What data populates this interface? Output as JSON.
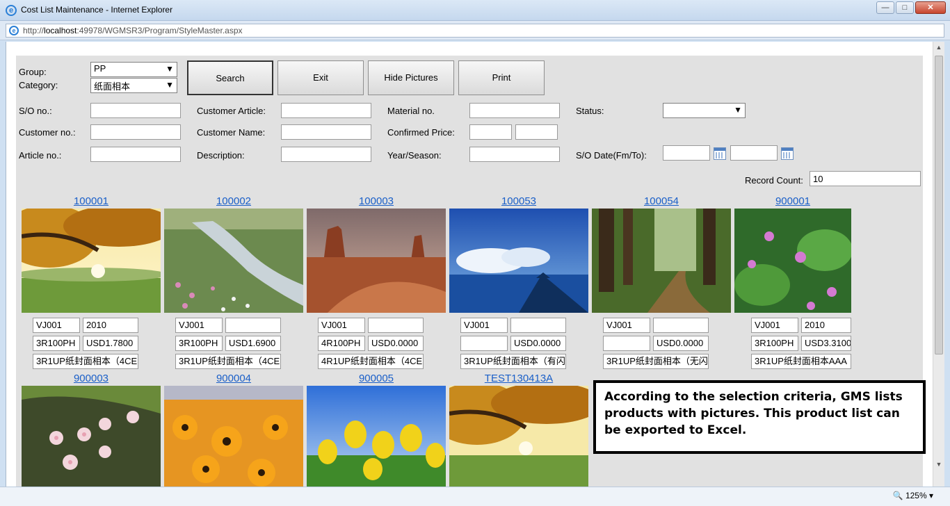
{
  "window": {
    "title": "Cost List Maintenance - Internet Explorer",
    "url_prefix": "http://",
    "url_host": "localhost",
    "url_rest": ":49978/WGMSR3/Program/StyleMaster.aspx"
  },
  "form": {
    "group_label": "Group:",
    "group_value": "PP",
    "category_label": "Category:",
    "category_value": "纸面相本",
    "buttons": {
      "search": "Search",
      "exit": "Exit",
      "hide_pictures": "Hide Pictures",
      "print": "Print"
    },
    "so_label": "S/O no.:",
    "customer_article_label": "Customer Article:",
    "material_label": "Material no.",
    "status_label": "Status:",
    "customer_no_label": "Customer no.:",
    "customer_name_label": "Customer Name:",
    "confirmed_price_label": "Confirmed Price:",
    "article_no_label": "Article no.:",
    "description_label": "Description:",
    "year_season_label": "Year/Season:",
    "so_date_label": "S/O Date(Fm/To):",
    "record_count_label": "Record Count:",
    "record_count_value": "10"
  },
  "products": [
    {
      "id": "100001",
      "a": "VJ001",
      "b": "2010",
      "c": "3R100PH",
      "d": "USD1.7800",
      "e": "3R1UP纸封面相本（4CE"
    },
    {
      "id": "100002",
      "a": "VJ001",
      "b": "",
      "c": "3R100PH",
      "d": "USD1.6900",
      "e": "3R1UP纸封面相本（4CE"
    },
    {
      "id": "100003",
      "a": "VJ001",
      "b": "",
      "c": "4R100PH",
      "d": "USD0.0000",
      "e": "4R1UP纸封面相本（4CE"
    },
    {
      "id": "100053",
      "a": "VJ001",
      "b": "",
      "c": "",
      "d": "USD0.0000",
      "e": "3R1UP纸封面相本（有闪"
    },
    {
      "id": "100054",
      "a": "VJ001",
      "b": "",
      "c": "",
      "d": "USD0.0000",
      "e": "3R1UP纸封面相本（无闪"
    },
    {
      "id": "900001",
      "a": "VJ001",
      "b": "2010",
      "c": "3R100PH",
      "d": "USD3.3100",
      "e": "3R1UP纸封面相本AAA"
    },
    {
      "id": "900003"
    },
    {
      "id": "900004"
    },
    {
      "id": "900005"
    },
    {
      "id": "TEST130413A"
    }
  ],
  "callout": "According to the selection criteria, GMS lists products with pictures.  This product list can be exported to Excel.",
  "status": {
    "zoom": "125%"
  },
  "colors": {
    "link": "#1a5fc8",
    "panel": "#e1e1e1"
  }
}
